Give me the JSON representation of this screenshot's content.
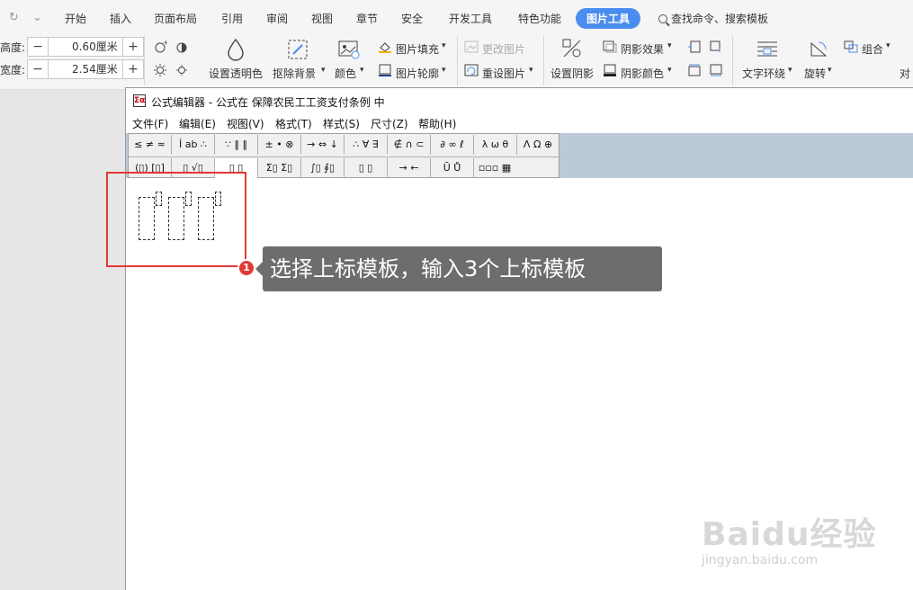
{
  "ribbon": {
    "tabs": [
      "开始",
      "插入",
      "页面布局",
      "引用",
      "审阅",
      "视图",
      "章节",
      "安全",
      "开发工具",
      "特色功能",
      "图片工具"
    ],
    "active_tab": "图片工具",
    "search": "查找命令、搜索模板",
    "height_label": "高度:",
    "height_value": "0.60厘米",
    "width_label": "宽度:",
    "width_value": "2.54厘米",
    "minus": "−",
    "plus": "+",
    "set_transparent": "设置透明色",
    "remove_bg": "抠除背景",
    "color": "颜色",
    "pic_fill": "图片填充",
    "pic_outline": "图片轮廓",
    "change_pic": "更改图片",
    "reset_pic": "重设图片",
    "set_shadow": "设置阴影",
    "shadow_effect": "阴影效果",
    "shadow_color": "阴影颜色",
    "text_wrap": "文字环绕",
    "rotate": "旋转",
    "group": "组合",
    "align": "对"
  },
  "editor": {
    "title": "公式编辑器 - 公式在 保障农民工工资支付条例 中",
    "app_icon_text": "Σα",
    "menus": [
      "文件(F)",
      "编辑(E)",
      "视图(V)",
      "格式(T)",
      "样式(S)",
      "尺寸(Z)",
      "帮助(H)"
    ],
    "toolbar_row1": [
      "≤ ≠ ≈",
      "İ ab ∴",
      "∵ ‖ ‖",
      "± • ⊗",
      "→ ⇔ ↓",
      "∴ ∀ ∃",
      "∉ ∩ ⊂",
      "∂ ∞ ℓ",
      "λ ω θ",
      "Λ Ω ⊕"
    ],
    "toolbar_row2": [
      "(▯) [▯]",
      "▯ √▯",
      "▯ ▯",
      "Σ▯ Σ▯",
      "∫▯ ∮▯",
      "▯ ▯",
      "→ ←",
      "Ū Ů",
      "▫▫▫ ▦"
    ]
  },
  "annotation": {
    "step": "1",
    "text": "选择上标模板，输入3个上标模板"
  },
  "watermark": {
    "brand": "Baidu经验",
    "url": "jingyan.baidu.com"
  },
  "colors": {
    "accent": "#4a8df0",
    "highlight": "#e53935",
    "tip_bg": "#6d6d6d"
  }
}
